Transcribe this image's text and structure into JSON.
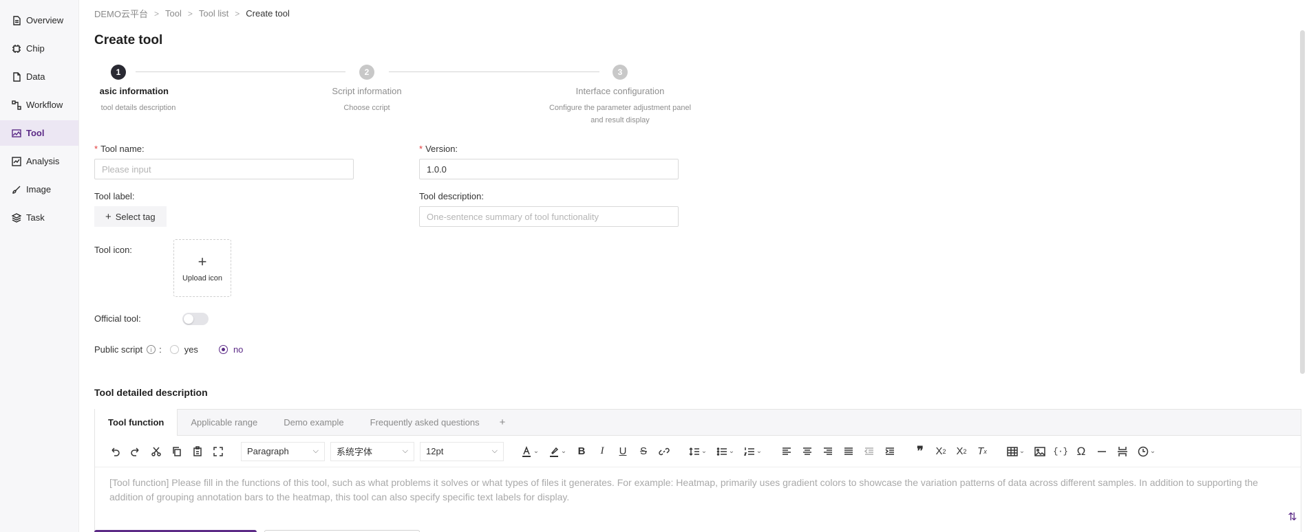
{
  "sidebar": {
    "items": [
      {
        "label": "Overview",
        "icon": "document-icon"
      },
      {
        "label": "Chip",
        "icon": "chip-icon"
      },
      {
        "label": "Data",
        "icon": "file-icon"
      },
      {
        "label": "Workflow",
        "icon": "workflow-icon"
      },
      {
        "label": "Tool",
        "icon": "image-tool-icon",
        "active": true
      },
      {
        "label": "Analysis",
        "icon": "analysis-icon"
      },
      {
        "label": "Image",
        "icon": "brush-icon"
      },
      {
        "label": "Task",
        "icon": "layers-icon"
      }
    ]
  },
  "breadcrumb": [
    "DEMO云平台",
    "Tool",
    "Tool list",
    "Create tool"
  ],
  "page": {
    "title": "Create tool"
  },
  "steps": [
    {
      "number": "1",
      "title": "asic information",
      "desc": "tool details description"
    },
    {
      "number": "2",
      "title": "Script information",
      "desc": "Choose ccript"
    },
    {
      "number": "3",
      "title": "Interface configuration",
      "desc": "Configure the parameter adjustment panel and result display"
    }
  ],
  "form": {
    "tool_name_label": "Tool name:",
    "tool_name_placeholder": "Please input",
    "version_label": "Version:",
    "version_value": "1.0.0",
    "tool_label_label": "Tool label:",
    "select_tag": "Select tag",
    "tool_description_label": "Tool description:",
    "tool_description_placeholder": "One-sentence summary of tool functionality",
    "tool_icon_label": "Tool icon:",
    "upload_icon": "Upload icon",
    "official_tool_label": "Official tool:",
    "public_script_label": "Public script",
    "public_script_colon": ":",
    "yes": "yes",
    "no": "no"
  },
  "description": {
    "title": "Tool detailed description",
    "tabs": [
      "Tool function",
      "Applicable range",
      "Demo example",
      "Frequently asked questions"
    ],
    "add_tab": "+",
    "toolbar": {
      "paragraph": "Paragraph",
      "font": "系统字体",
      "size": "12pt"
    },
    "content": "[Tool function] Please fill in the functions of this tool, such as what problems it solves or what types of files it generates. For example: Heatmap, primarily uses gradient colors to showcase the variation patterns of data across different samples. In addition to supporting the addition of grouping annotation bars to the heatmap, this tool can also specify specific text labels for display."
  },
  "colors": {
    "accent": "#5b2a86",
    "required": "#e23b3b"
  }
}
